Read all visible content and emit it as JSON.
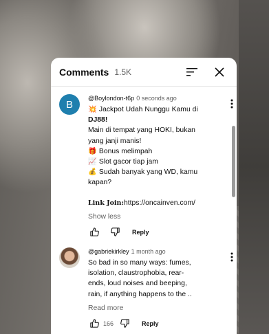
{
  "panel": {
    "title": "Comments",
    "count": "1.5K"
  },
  "comments": [
    {
      "author": "@Boylondon-t6p",
      "time": "0 seconds ago",
      "avatar_letter": "B",
      "lines": [
        {
          "emoji": "💥",
          "text": "Jackpot Udah Nunggu Kamu di"
        },
        {
          "text": "DJ88!"
        },
        {
          "text": "Main di tempat yang HOKI, bukan"
        },
        {
          "text": "yang janji manis!"
        },
        {
          "emoji": "🎁",
          "text": "Bonus melimpah"
        },
        {
          "emoji": "📈",
          "text": "Slot gacor tiap jam"
        },
        {
          "emoji": "💰",
          "text": "Sudah banyak yang WD, kamu"
        },
        {
          "text": "kapan?"
        },
        {
          "label": "Link Join",
          "text": "https://oncainven.com/"
        }
      ],
      "toggle_label": "Show less",
      "reply_label": "Reply"
    },
    {
      "author": "@gabriekirkley",
      "time": "1 month ago",
      "lines": [
        "So bad in so many ways: fumes,",
        "isolation, claustrophobia, rear-",
        "ends, loud noises and beeping,",
        "rain, if anything happens to the .."
      ],
      "toggle_label": "Read more",
      "likes": "166",
      "reply_label": "Reply"
    }
  ],
  "icons": {
    "sort": "sort-icon",
    "close": "close-icon",
    "more": "more-vert-icon",
    "like": "thumb-up-icon",
    "dislike": "thumb-down-icon"
  },
  "colors": {
    "avatar_b": "#1f7fae",
    "text": "#0f0f0f",
    "secondary": "#606060"
  }
}
